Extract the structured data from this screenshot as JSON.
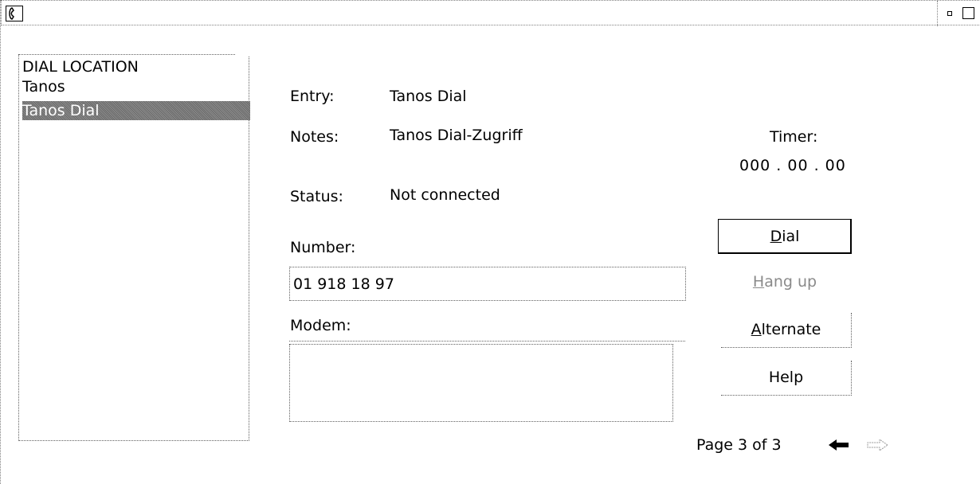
{
  "window": {
    "system_menu_icon": "phone-icon",
    "minimize_icon": "minimize-icon",
    "maximize_icon": "maximize-icon"
  },
  "list": {
    "header": "DIAL LOCATION",
    "items": [
      {
        "label": "Tanos",
        "selected": false
      },
      {
        "label": "Tanos Dial",
        "selected": true
      }
    ]
  },
  "details": {
    "entry_label": "Entry:",
    "entry_value": "Tanos Dial",
    "notes_label": "Notes:",
    "notes_value": "Tanos Dial-Zugriff",
    "status_label": "Status:",
    "status_value": "Not connected",
    "timer_label": "Timer:",
    "timer_value": "000 . 00 . 00"
  },
  "number": {
    "label": "Number:",
    "value": "01 918 18 97"
  },
  "modem": {
    "label": "Modem:",
    "value": ""
  },
  "buttons": {
    "dial": {
      "mnemonic": "D",
      "rest": "ial"
    },
    "hangup": {
      "mnemonic": "H",
      "rest": "ang up"
    },
    "alternate": {
      "mnemonic": "A",
      "rest": "lternate"
    },
    "help": {
      "label": "Help"
    }
  },
  "pager": {
    "text": "Page 3 of 3",
    "prev_icon": "arrow-left-icon",
    "next_icon": "arrow-right-icon",
    "next_disabled": true
  }
}
